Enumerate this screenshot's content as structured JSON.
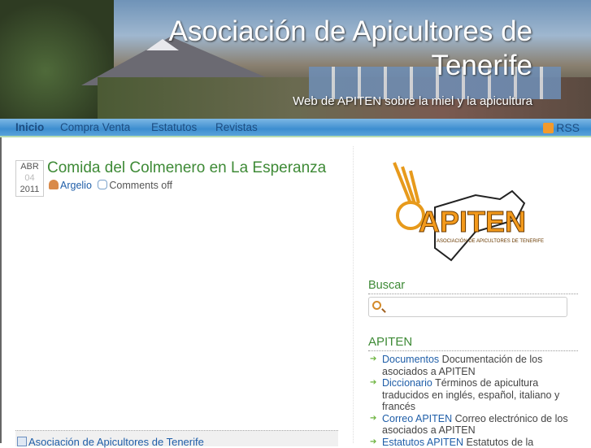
{
  "header": {
    "title": "Asociación de Apicultores de Tenerife",
    "description": "Web de APITEN sobre la miel y la apicultura"
  },
  "nav": {
    "items": [
      "Inicio",
      "Compra Venta",
      "Estatutos",
      "Revistas"
    ],
    "rss": "RSS"
  },
  "post": {
    "month": "ABR",
    "day": "04",
    "year": "2011",
    "title": "Comida del Colmenero en La Esperanza",
    "author": "Argelio",
    "comments": "Comments off"
  },
  "related": {
    "label": "Asociación de Apicultores de Tenerife"
  },
  "sidebar": {
    "logo_text": "APITEN",
    "logo_sub": "ASOCIACIÓN DE APICULTORES DE TENERIFE",
    "search_title": "Buscar",
    "apiten_title": "APITEN",
    "links": [
      {
        "name": "Documentos",
        "desc": "Documentación de los asociados a APITEN"
      },
      {
        "name": "Diccionario",
        "desc": "Términos de apicultura traducidos en inglés, español, italiano y francés"
      },
      {
        "name": "Correo APITEN",
        "desc": "Correo electrónico de los asociados a APITEN"
      },
      {
        "name": "Estatutos APITEN",
        "desc": "Estatutos de la"
      }
    ]
  },
  "colors": {
    "nav": "#3d8ed0",
    "accent_green": "#3e8a36",
    "link": "#1f5ea8"
  }
}
